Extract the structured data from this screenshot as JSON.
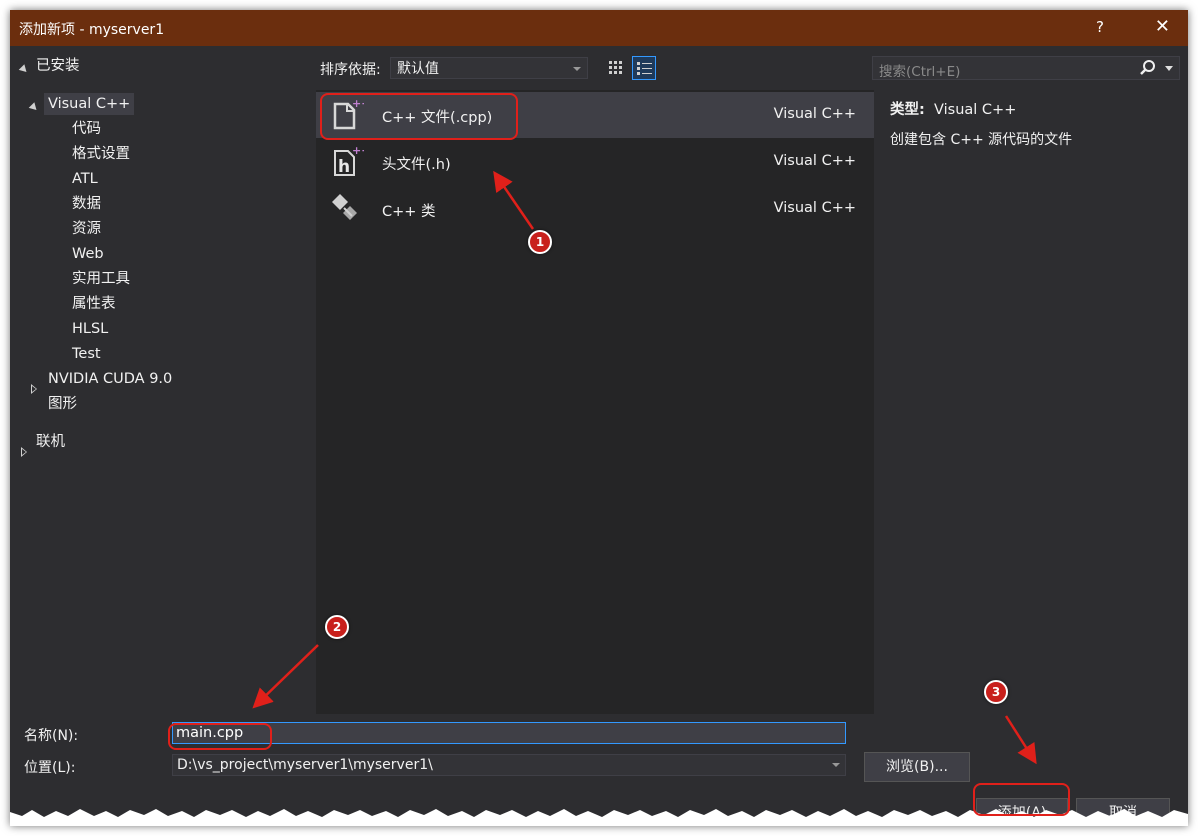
{
  "window": {
    "title": "添加新项 - myserver1",
    "help": "?",
    "close": "✕"
  },
  "tree": {
    "installed": "已安装",
    "visual_cpp": "Visual C++",
    "children": [
      "代码",
      "格式设置",
      "ATL",
      "数据",
      "资源",
      "Web",
      "实用工具",
      "属性表",
      "HLSL",
      "Test"
    ],
    "cuda": "NVIDIA CUDA 9.0",
    "graphics": "图形",
    "online": "联机"
  },
  "toolbar": {
    "sort_label": "排序依据:",
    "sort_value": "默认值"
  },
  "items": [
    {
      "name": "C++ 文件(.cpp)",
      "lang": "Visual C++"
    },
    {
      "name": "头文件(.h)",
      "lang": "Visual C++"
    },
    {
      "name": "C++ 类",
      "lang": "Visual C++"
    }
  ],
  "search": {
    "placeholder": "搜索(Ctrl+E)"
  },
  "detail": {
    "type_label": "类型:",
    "type_value": "Visual C++",
    "description": "创建包含 C++ 源代码的文件"
  },
  "form": {
    "name_label": "名称(N):",
    "name_value": "main.cpp",
    "location_label": "位置(L):",
    "location_value": "D:\\vs_project\\myserver1\\myserver1\\",
    "browse": "浏览(B)...",
    "add": "添加(A)",
    "cancel": "取消"
  },
  "annotations": [
    "1",
    "2",
    "3"
  ],
  "colors": {
    "titlebar": "#6b2e0e",
    "background": "#2d2d30",
    "annotation_red": "#e0201a",
    "accent": "#3399ff"
  }
}
